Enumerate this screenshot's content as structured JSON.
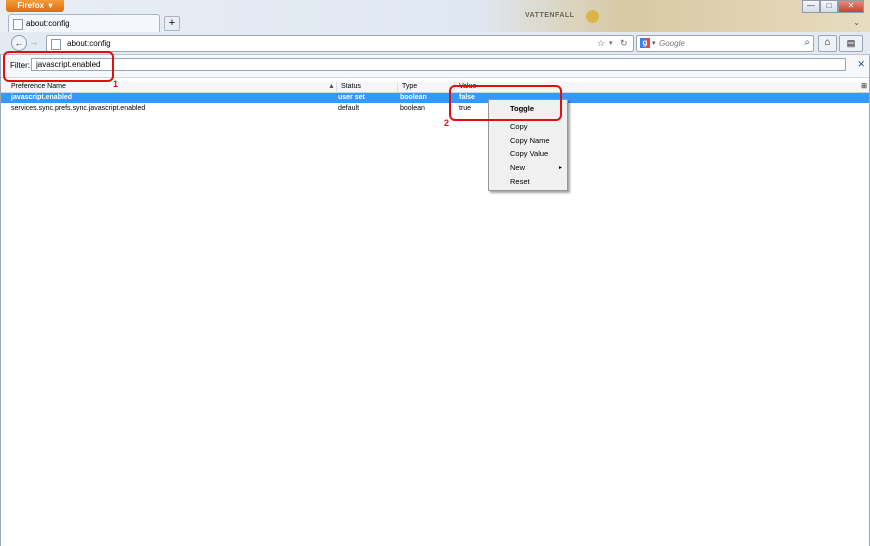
{
  "browser": {
    "menu_button": "Firefox",
    "tab_title": "about:config",
    "new_tab_symbol": "+",
    "logo_text": "VATTENFALL",
    "minimize": "—",
    "maximize": "□",
    "close": "✕",
    "list_all_tabs": "⌄"
  },
  "navbar": {
    "back": "←",
    "forward": "→",
    "url": "about:config",
    "bookmark_star": "☆",
    "dropdown": "▾",
    "reload": "↻",
    "search_engine": "g",
    "search_dropdown": "▾",
    "search_placeholder": "Google",
    "search_go": "⌕",
    "home": "⌂",
    "menu": "▤"
  },
  "filter": {
    "label": "Filter:",
    "value": "javascript.enabled",
    "clear": "✕"
  },
  "table": {
    "headers": {
      "name": "Preference Name",
      "status": "Status",
      "type": "Type",
      "value": "Value",
      "sort_indicator": "▲",
      "column_picker": "⊞"
    },
    "rows": [
      {
        "name": "javascript.enabled",
        "status": "user set",
        "type": "boolean",
        "value": "false"
      },
      {
        "name": "services.sync.prefs.sync.javascript.enabled",
        "status": "default",
        "type": "boolean",
        "value": "true"
      }
    ]
  },
  "context_menu": {
    "items": [
      {
        "label": "Toggle"
      },
      {
        "label": "Copy"
      },
      {
        "label": "Copy Name"
      },
      {
        "label": "Copy Value"
      },
      {
        "label": "New",
        "submenu_arrow": "▸"
      },
      {
        "label": "Reset"
      }
    ]
  },
  "annotations": {
    "step1": "1",
    "step2": "2",
    "color": "#e01010"
  },
  "colors": {
    "selection": "#3399ff",
    "firefox_button": "#e97a1d"
  }
}
